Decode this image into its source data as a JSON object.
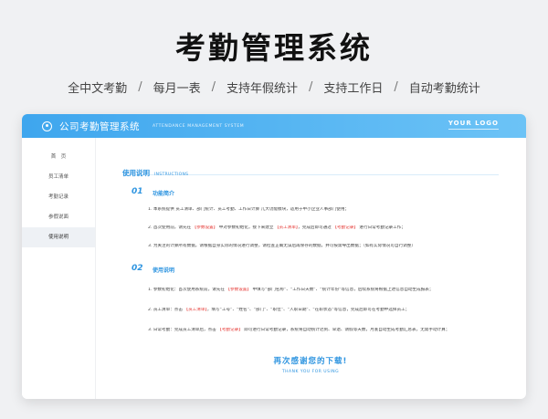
{
  "hero": {
    "title": "考勤管理系统",
    "features": [
      "全中文考勤",
      "每月一表",
      "支持年假统计",
      "支持工作日",
      "自动考勤统计"
    ],
    "separator": "/"
  },
  "app": {
    "title": "公司考勤管理系统",
    "subtitle": "ATTENDANCE MANAGEMENT SYSTEM",
    "logo_text": "YOUR LOGO",
    "accent_color": "#3ea6ee"
  },
  "sidebar": {
    "items": [
      {
        "label": "首　页"
      },
      {
        "label": "员工清单"
      },
      {
        "label": "考勤记录"
      },
      {
        "label": "参假说面"
      },
      {
        "label": "使用说明"
      }
    ],
    "active_index": 4
  },
  "main": {
    "heading": "使用说明",
    "heading_en": "INSTRUCTIONS",
    "sections": [
      {
        "num": "01",
        "title": "功能简介",
        "paras": [
          "1. 本系统提供 员工清单、部门统计、员工考勤、工作日计算 几大功能模块，适用于中小企业人事部门使用；",
          "2. 首次使用前，请先在 【参数设置】 中对参数初始化，接下来建立 【员工清单】，完成后即可通过 【考勤记录】 进行日常考勤记录工作；",
          "3. 为关注的计算所有数据，请根据自身实际的情况进行调整，请检查正确无误后再保存的数据，并可按需导出数据；（如有实际情况可自行调整）"
        ]
      },
      {
        "num": "02",
        "title": "使用说明",
        "paras": [
          "1. 参数初始化：首次使用系统前，请先在 【参数设置】 中填写“部门名称”、“工作日天数”、“统计年份”等信息，后续系统将根据上述信息自动生成报表；",
          "2. 员工清单：点击 【员工清单】，填写“工号”、“姓名”、“部门”、“职位”、“入职日期”、“在职状态”等信息，完成后即可在考勤中选择员工；",
          "3. 日常考勤：完成员工清单后，点击 【考勤记录】 即可进行日常考勤记录，系统将自动统计迟到、早退、请假等天数，月底自动生成考勤汇总表，无需手动计算；"
        ],
        "highlights": [
          "【参数设置】",
          "【员工清单】",
          "【考勤记录】"
        ]
      }
    ],
    "thanks": "再次感谢您的下载!",
    "thanks_en": "THANK YOU FOR USING"
  }
}
